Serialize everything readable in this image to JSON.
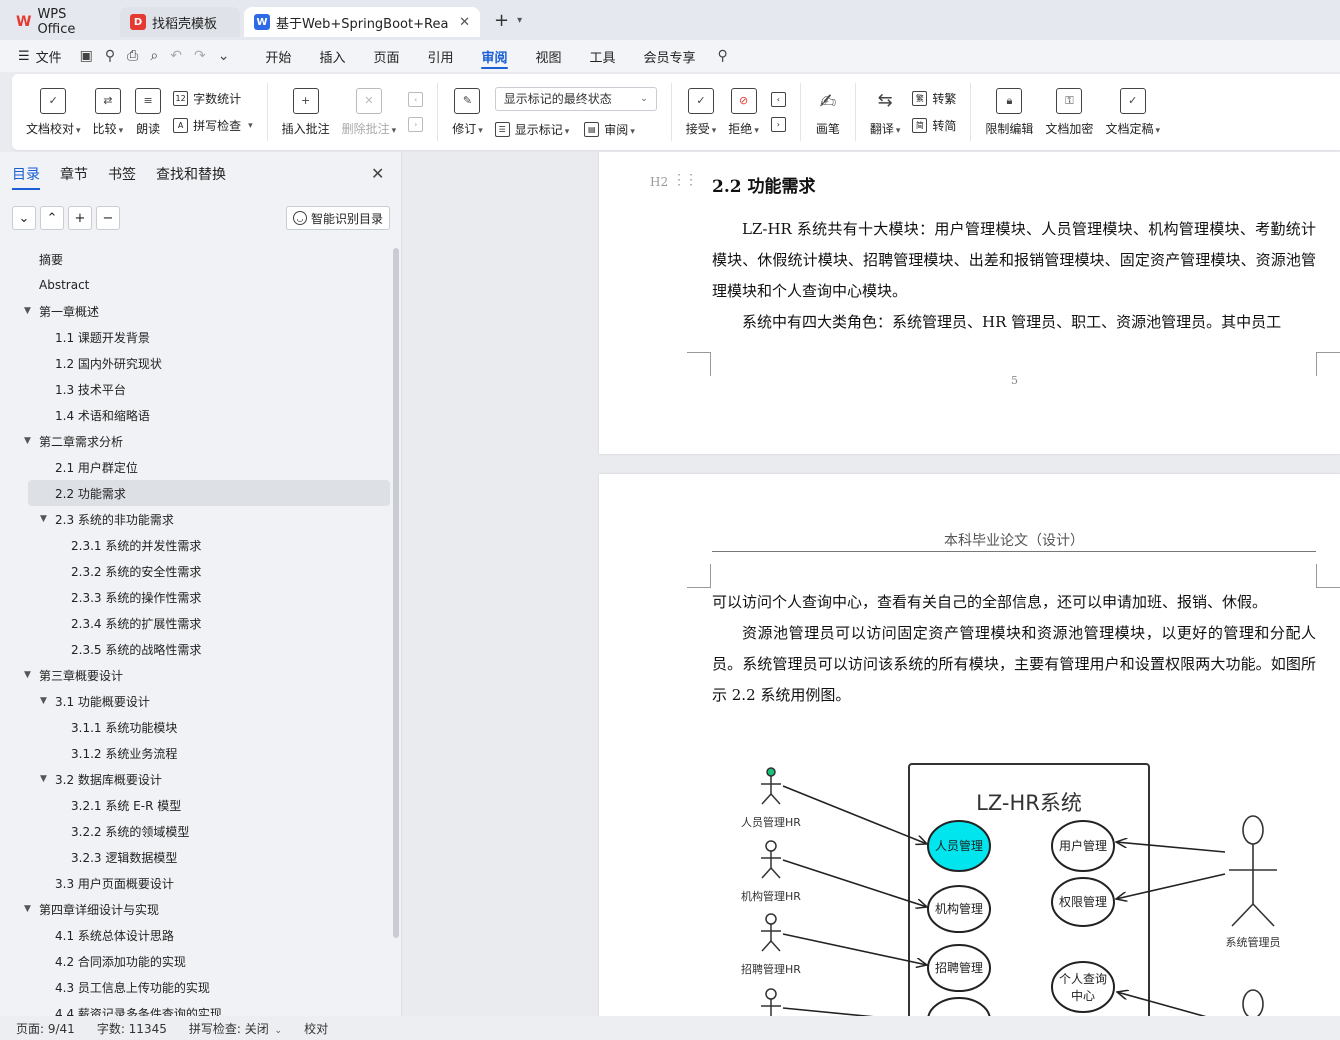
{
  "tabs": [
    {
      "title": "WPS Office"
    },
    {
      "title": "找稻壳模板"
    },
    {
      "title": "基于Web+SpringBoot+Rea"
    }
  ],
  "menubar": {
    "file_label": "文件",
    "items": [
      "开始",
      "插入",
      "页面",
      "引用",
      "审阅",
      "视图",
      "工具",
      "会员专享"
    ],
    "active": "审阅"
  },
  "ribbon": {
    "doc_check": "文档校对",
    "compare": "比较",
    "read_aloud": "朗读",
    "word_count": "字数统计",
    "spell_check": "拼写检查",
    "insert_comment": "插入批注",
    "delete_comment": "删除批注",
    "revise": "修订",
    "markup_select": "显示标记的最终状态",
    "show_markup": "显示标记",
    "review": "审阅",
    "accept": "接受",
    "reject": "拒绝",
    "pen": "画笔",
    "translate": "翻译",
    "to_traditional": "转繁",
    "to_simplified": "转简",
    "restrict_edit": "限制编辑",
    "encrypt": "文档加密",
    "finalize": "文档定稿"
  },
  "nav": {
    "tabs": [
      "目录",
      "章节",
      "书签",
      "查找和替换"
    ],
    "smart_toc": "智能识别目录",
    "toc": [
      {
        "text": "摘要",
        "level": 1,
        "arrow": false
      },
      {
        "text": "Abstract",
        "level": 1,
        "arrow": false
      },
      {
        "text": "第一章概述",
        "level": 1,
        "arrow": true
      },
      {
        "text": "1.1  课题开发背景",
        "level": 2,
        "arrow": false
      },
      {
        "text": "1.2  国内外研究现状",
        "level": 2,
        "arrow": false
      },
      {
        "text": "1.3  技术平台",
        "level": 2,
        "arrow": false
      },
      {
        "text": "1.4  术语和缩略语",
        "level": 2,
        "arrow": false
      },
      {
        "text": "第二章需求分析",
        "level": 1,
        "arrow": true
      },
      {
        "text": "2.1  用户群定位",
        "level": 2,
        "arrow": false
      },
      {
        "text": "2.2  功能需求",
        "level": 2,
        "arrow": false,
        "selected": true
      },
      {
        "text": "2.3  系统的非功能需求",
        "level": 2,
        "arrow": true
      },
      {
        "text": "2.3.1  系统的并发性需求",
        "level": 3,
        "arrow": false
      },
      {
        "text": "2.3.2  系统的安全性需求",
        "level": 3,
        "arrow": false
      },
      {
        "text": "2.3.3  系统的操作性需求",
        "level": 3,
        "arrow": false
      },
      {
        "text": "2.3.4  系统的扩展性需求",
        "level": 3,
        "arrow": false
      },
      {
        "text": "2.3.5  系统的战略性需求",
        "level": 3,
        "arrow": false
      },
      {
        "text": "第三章概要设计",
        "level": 1,
        "arrow": true
      },
      {
        "text": "3.1  功能概要设计",
        "level": 2,
        "arrow": true
      },
      {
        "text": "3.1.1  系统功能模块",
        "level": 3,
        "arrow": false
      },
      {
        "text": "3.1.2  系统业务流程",
        "level": 3,
        "arrow": false
      },
      {
        "text": "3.2  数据库概要设计",
        "level": 2,
        "arrow": true
      },
      {
        "text": "3.2.1  系统 E-R 模型",
        "level": 3,
        "arrow": false
      },
      {
        "text": "3.2.2  系统的领域模型",
        "level": 3,
        "arrow": false
      },
      {
        "text": "3.2.3  逻辑数据模型",
        "level": 3,
        "arrow": false
      },
      {
        "text": "3.3  用户页面概要设计",
        "level": 2,
        "arrow": false
      },
      {
        "text": "第四章详细设计与实现",
        "level": 1,
        "arrow": true
      },
      {
        "text": "4.1  系统总体设计思路",
        "level": 2,
        "arrow": false
      },
      {
        "text": "4.2  合同添加功能的实现",
        "level": 2,
        "arrow": false
      },
      {
        "text": "4.3  员工信息上传功能的实现",
        "level": 2,
        "arrow": false
      },
      {
        "text": "4.4  薪资记录多条件查询的实现",
        "level": 2,
        "arrow": false
      }
    ]
  },
  "doc": {
    "heading": "2.2  功能需求",
    "heading_style": "H2",
    "para1": "LZ-HR 系统共有十大模块：用户管理模块、人员管理模块、机构管理模块、考勤统计模块、休假统计模块、招聘管理模块、出差和报销管理模块、固定资产管理模块、资源池管理模块和个人查询中心模块。",
    "para2": "系统中有四大类角色：系统管理员、HR 管理员、职工、资源池管理员。其中员工",
    "page_number": "5",
    "page2_header": "本科毕业论文（设计）",
    "para3": "可以访问个人查询中心，查看有关自己的全部信息，还可以申请加班、报销、休假。",
    "para4": "资源池管理员可以访问固定资产管理模块和资源池管理模块，以更好的管理和分配人员。系统管理员可以访问该系统的所有模块，主要有管理用户和设置权限两大功能。如图所示 2.2 系统用例图。",
    "diagram": {
      "system_title": "LZ-HR系统",
      "actors_left": [
        "人员管理HR",
        "机构管理HR",
        "招聘管理HR"
      ],
      "actor_right": "系统管理员",
      "usecases_left": [
        "人员管理",
        "机构管理",
        "招聘管理"
      ],
      "usecases_right": [
        "用户管理",
        "权限管理"
      ],
      "usecase_personal_1": "个人查询",
      "usecase_personal_2": "中心",
      "highlight_color": "#00e5ee"
    }
  },
  "status": {
    "page": "页面: 9/41",
    "words": "字数: 11345",
    "spell": "拼写检查: 关闭",
    "proof": "校对"
  }
}
